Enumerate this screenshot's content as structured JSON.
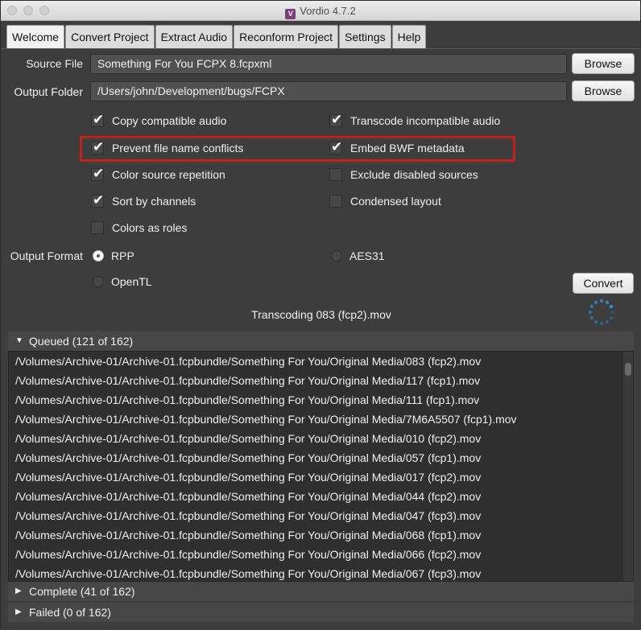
{
  "window": {
    "title": "Vordio 4.7.2",
    "app_icon_letter": "V"
  },
  "tabs": [
    "Welcome",
    "Convert Project",
    "Extract Audio",
    "Reconform Project",
    "Settings",
    "Help"
  ],
  "source": {
    "label": "Source File",
    "value": "Something For You FCPX 8.fcpxml",
    "browse": "Browse"
  },
  "output": {
    "label": "Output Folder",
    "value": "/Users/john/Development/bugs/FCPX",
    "browse": "Browse"
  },
  "options": [
    {
      "label": "Copy compatible audio",
      "checked": true
    },
    {
      "label": "Transcode incompatible audio",
      "checked": true
    },
    {
      "label": "Prevent file name conflicts",
      "checked": true
    },
    {
      "label": "Embed BWF metadata",
      "checked": true
    },
    {
      "label": "Color source repetition",
      "checked": true
    },
    {
      "label": "Exclude disabled sources",
      "checked": false
    },
    {
      "label": "Sort by channels",
      "checked": true
    },
    {
      "label": "Condensed layout",
      "checked": false
    },
    {
      "label": "Colors as roles",
      "checked": false
    }
  ],
  "format": {
    "label": "Output Format",
    "options": [
      {
        "label": "RPP",
        "selected": true
      },
      {
        "label": "AES31",
        "selected": false
      },
      {
        "label": "OpenTL",
        "selected": false
      }
    ],
    "convert": "Convert"
  },
  "status": "Transcoding 083 (fcp2).mov",
  "queued": {
    "header": "Queued (121 of 162)",
    "items": [
      "/Volumes/Archive-01/Archive-01.fcpbundle/Something For You/Original Media/083 (fcp2).mov",
      "/Volumes/Archive-01/Archive-01.fcpbundle/Something For You/Original Media/117 (fcp1).mov",
      "/Volumes/Archive-01/Archive-01.fcpbundle/Something For You/Original Media/111 (fcp1).mov",
      "/Volumes/Archive-01/Archive-01.fcpbundle/Something For You/Original Media/7M6A5507 (fcp1).mov",
      "/Volumes/Archive-01/Archive-01.fcpbundle/Something For You/Original Media/010 (fcp2).mov",
      "/Volumes/Archive-01/Archive-01.fcpbundle/Something For You/Original Media/057 (fcp1).mov",
      "/Volumes/Archive-01/Archive-01.fcpbundle/Something For You/Original Media/017 (fcp2).mov",
      "/Volumes/Archive-01/Archive-01.fcpbundle/Something For You/Original Media/044 (fcp2).mov",
      "/Volumes/Archive-01/Archive-01.fcpbundle/Something For You/Original Media/047 (fcp3).mov",
      "/Volumes/Archive-01/Archive-01.fcpbundle/Something For You/Original Media/068 (fcp1).mov",
      "/Volumes/Archive-01/Archive-01.fcpbundle/Something For You/Original Media/066 (fcp2).mov",
      "/Volumes/Archive-01/Archive-01.fcpbundle/Something For You/Original Media/067 (fcp3).mov"
    ]
  },
  "complete": {
    "header": "Complete (41 of 162)"
  },
  "failed": {
    "header": "Failed (0 of 162)"
  },
  "colors": {
    "highlight": "#c2211c",
    "spinner": "#2a8fd6"
  }
}
